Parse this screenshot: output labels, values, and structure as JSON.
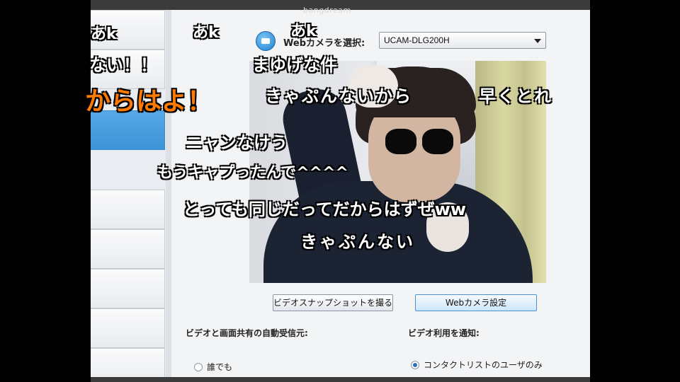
{
  "window": {
    "brand": "bangdream",
    "camera_select_label": "Webカメラを選択:",
    "camera_selected": "UCAM-DLG200H",
    "snapshot_button": "ビデオスナップショットを撮る",
    "settings_button": "Webカメラ設定",
    "auto_receive_label": "ビデオと画面共有の自動受信元:",
    "notify_label": "ビデオ利用を通知:",
    "radio_anyone": "誰でも",
    "radio_contacts_only": "コンタクトリストのユーザのみ"
  },
  "comments": [
    "あk",
    "あk",
    "あk",
    "ない！！",
    "からはよ！",
    "まゆげな件",
    "きゃぷんないから",
    "早くとれ",
    "ニャンなけう",
    "もうキャプったんで^^^^",
    "とっても同じだってだからはずぜww",
    "きゃぷんない"
  ],
  "colors": {
    "accent": "#3c93d7",
    "comment_text": "#ffffff",
    "comment_highlight": "#ff7a00"
  },
  "icons": {
    "camera": "camera-icon",
    "dropdown": "chevron-down-icon"
  }
}
